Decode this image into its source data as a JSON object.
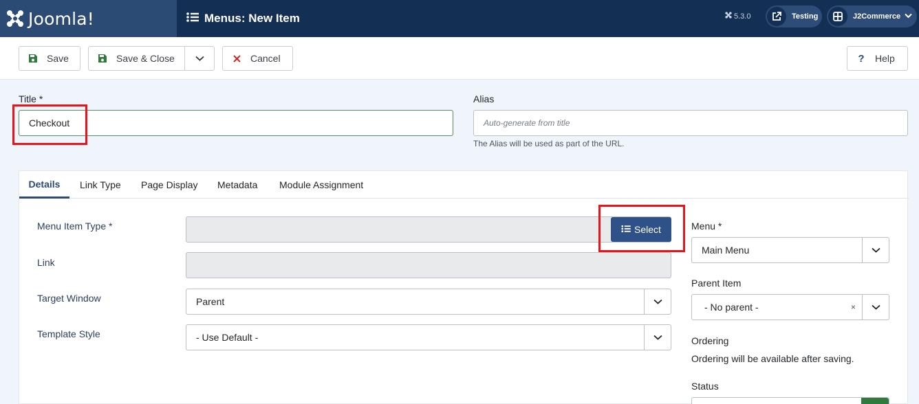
{
  "header": {
    "logo_text": "Joomla!",
    "page_title": "Menus: New Item",
    "version": "5.3.0",
    "testing_label": "Testing",
    "user_label": "J2Commerce"
  },
  "toolbar": {
    "save_label": "Save",
    "save_close_label": "Save & Close",
    "cancel_label": "Cancel",
    "help_label": "Help"
  },
  "form": {
    "title_label": "Title *",
    "title_value": "Checkout",
    "alias_label": "Alias",
    "alias_placeholder": "Auto-generate from title",
    "alias_hint": "The Alias will be used as part of the URL."
  },
  "tabs": [
    {
      "label": "Details"
    },
    {
      "label": "Link Type"
    },
    {
      "label": "Page Display"
    },
    {
      "label": "Metadata"
    },
    {
      "label": "Module Assignment"
    }
  ],
  "details": {
    "menu_item_type_label": "Menu Item Type *",
    "select_button_label": "Select",
    "link_label": "Link",
    "target_window_label": "Target Window",
    "target_window_value": "Parent",
    "template_style_label": "Template Style",
    "template_style_value": "- Use Default -",
    "menu_label": "Menu *",
    "menu_value": "Main Menu",
    "parent_item_label": "Parent Item",
    "parent_item_value": "- No parent -",
    "clear_symbol": "×",
    "ordering_label": "Ordering",
    "ordering_text": "Ordering will be available after saving.",
    "status_label": "Status"
  },
  "colors": {
    "header_bg": "#132f53",
    "logo_bg": "#2b4a74",
    "select_button": "#2e5287",
    "highlight": "#e8141b",
    "save_icon": "#2f7a3c",
    "cancel_icon": "#c52827"
  }
}
